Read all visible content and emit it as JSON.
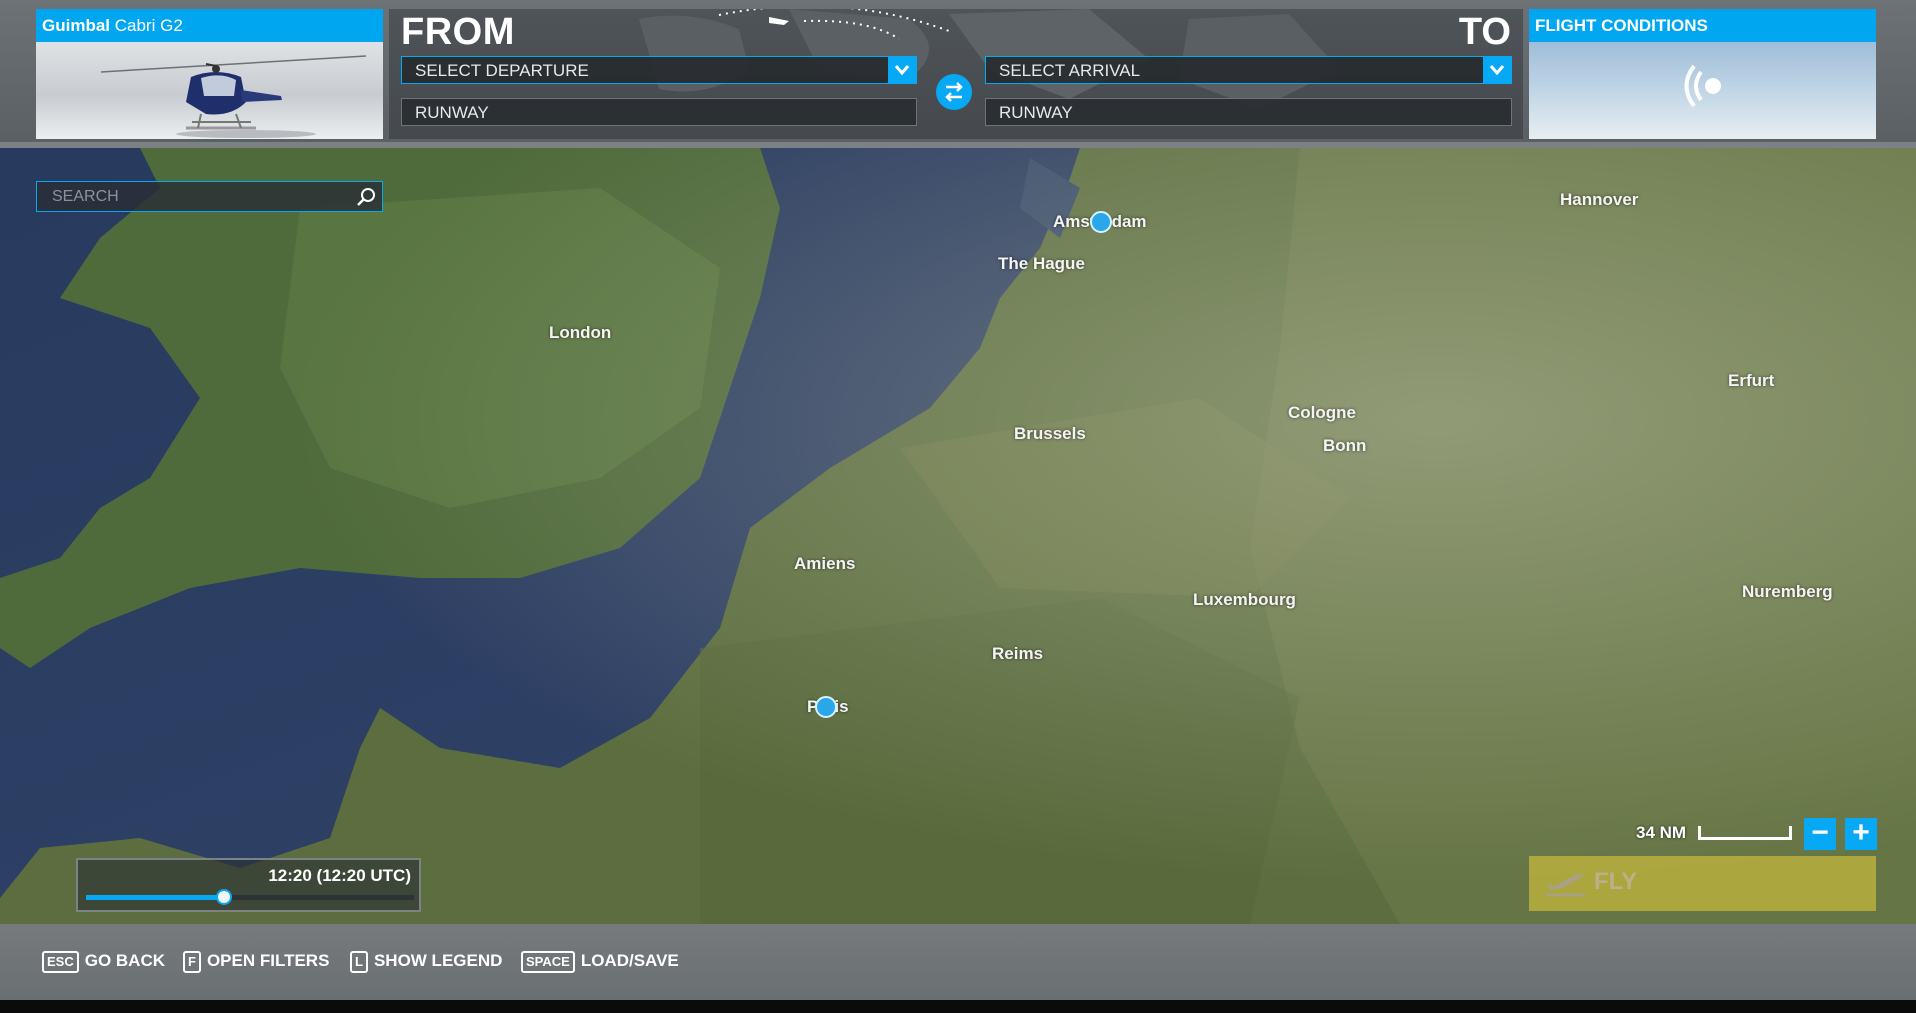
{
  "aircraft": {
    "brand": "Guimbal",
    "model": "Cabri G2"
  },
  "route": {
    "from_label": "FROM",
    "to_label": "TO",
    "departure_placeholder": "SELECT DEPARTURE",
    "arrival_placeholder": "SELECT ARRIVAL",
    "departure_runway": "RUNWAY",
    "arrival_runway": "RUNWAY"
  },
  "conditions": {
    "title": "FLIGHT CONDITIONS"
  },
  "search": {
    "placeholder": "SEARCH"
  },
  "map": {
    "cities": [
      {
        "name": "Amsterdam"
      },
      {
        "name": "Hannover"
      },
      {
        "name": "The Hague"
      },
      {
        "name": "London"
      },
      {
        "name": "Erfurt"
      },
      {
        "name": "Cologne"
      },
      {
        "name": "Brussels"
      },
      {
        "name": "Bonn"
      },
      {
        "name": "Amiens"
      },
      {
        "name": "Luxembourg"
      },
      {
        "name": "Nuremberg"
      },
      {
        "name": "Reims"
      },
      {
        "name": "Paris"
      }
    ],
    "scale_label": "34 NM"
  },
  "time": {
    "value": "12:20 (12:20 UTC)",
    "progress": 0.42
  },
  "zoom": {
    "out_label": "−",
    "in_label": "+"
  },
  "fly_button": {
    "label": "FLY"
  },
  "shortcuts": [
    {
      "key": "ESC",
      "label": "GO BACK"
    },
    {
      "key": "F",
      "label": "OPEN FILTERS"
    },
    {
      "key": "L",
      "label": "SHOW LEGEND"
    },
    {
      "key": "SPACE",
      "label": "LOAD/SAVE"
    }
  ],
  "colors": {
    "accent": "#08a9f4",
    "fly_button": "#c8ba3c"
  }
}
